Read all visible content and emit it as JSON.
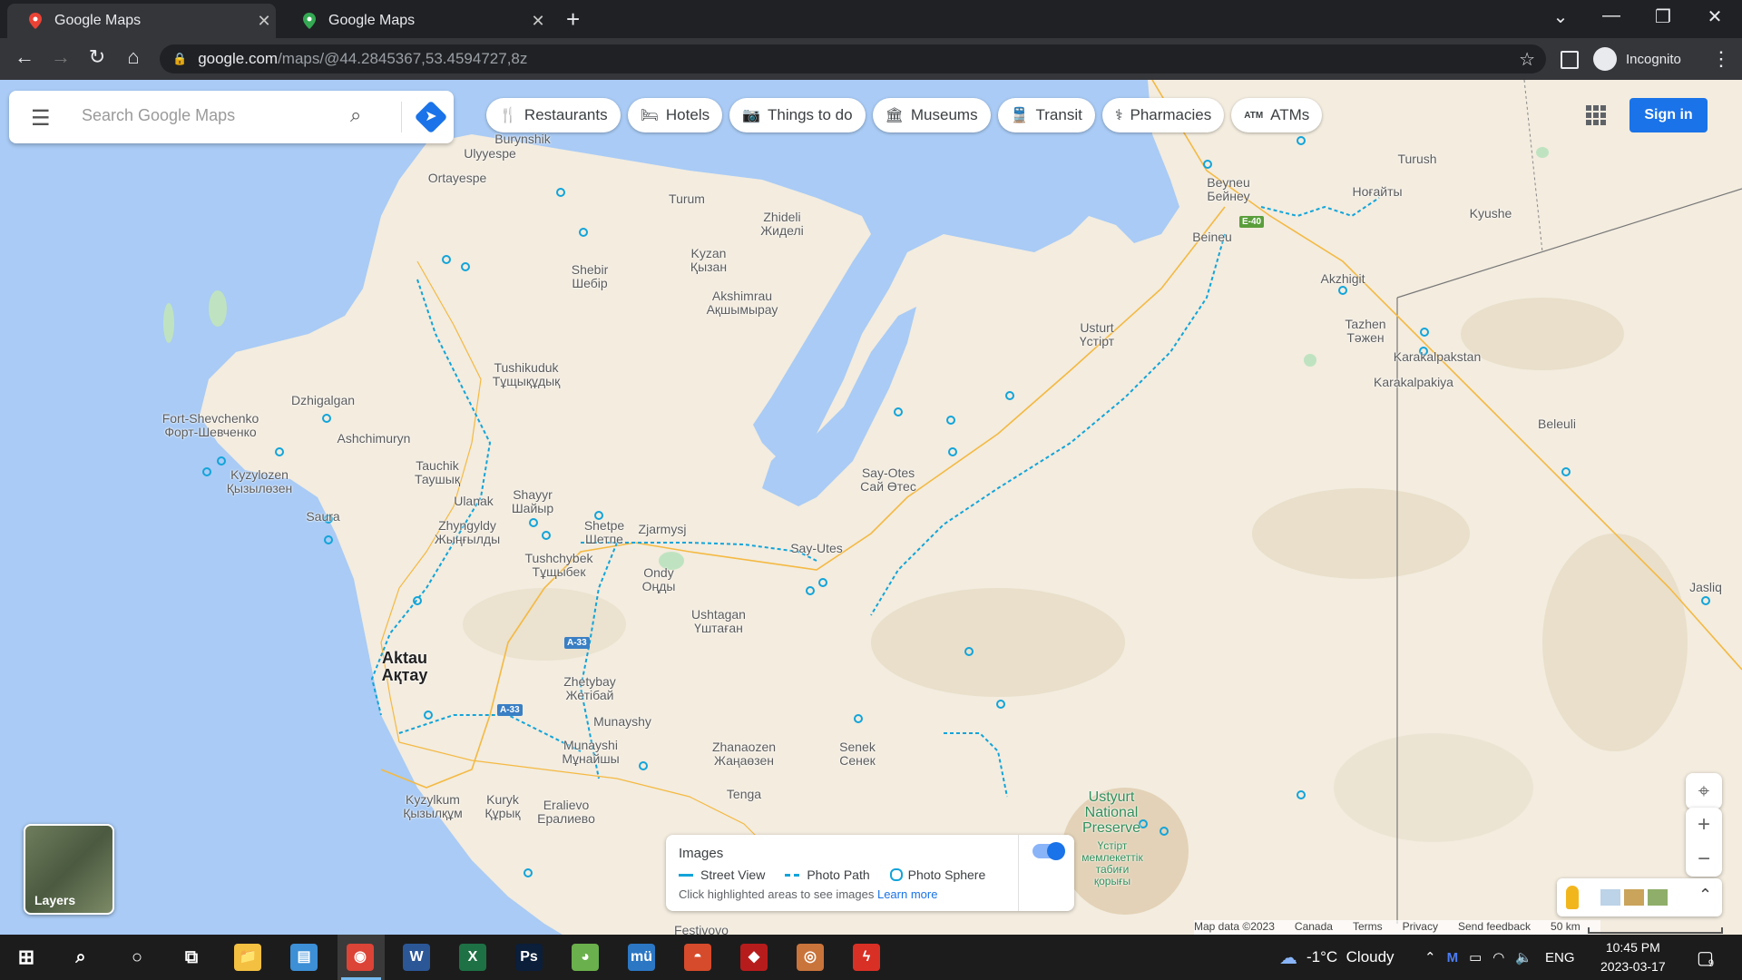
{
  "browser": {
    "tabs": [
      {
        "title": "Google Maps",
        "close": "✕"
      },
      {
        "title": "Google Maps",
        "close": "✕"
      }
    ],
    "new_tab": "+",
    "window_controls": [
      "⌄",
      "—",
      "❐",
      "✕"
    ],
    "nav": {
      "back": "←",
      "forward": "→",
      "reload": "↻",
      "home": "⌂"
    },
    "url_host": "google.com",
    "url_path": "/maps/@44.2845367,53.4594727,8z",
    "profile_label": "Incognito",
    "menu": "⋮",
    "bookmark": "☆"
  },
  "maps": {
    "search_placeholder": "Search Google Maps",
    "chips": [
      {
        "icon": "restaurant-icon",
        "glyph": "🍴",
        "label": "Restaurants"
      },
      {
        "icon": "hotel-icon",
        "glyph": "🛏",
        "label": "Hotels"
      },
      {
        "icon": "camera-icon",
        "glyph": "📷",
        "label": "Things to do"
      },
      {
        "icon": "museum-icon",
        "glyph": "🏛",
        "label": "Museums"
      },
      {
        "icon": "transit-icon",
        "glyph": "🚆",
        "label": "Transit"
      },
      {
        "icon": "pharmacy-icon",
        "glyph": "⚕",
        "label": "Pharmacies"
      },
      {
        "icon": "atm-icon",
        "glyph": "ATM",
        "label": "ATMs"
      }
    ],
    "sign_in": "Sign in",
    "layers_label": "Layers",
    "images_panel": {
      "title": "Images",
      "street_view": "Street View",
      "photo_path": "Photo Path",
      "photo_sphere": "Photo Sphere",
      "hint": "Click highlighted areas to see images",
      "learn_more": "Learn more",
      "toggle_on": true
    },
    "footer": {
      "map_data": "Map data ©2023",
      "region": "Canada",
      "terms": "Terms",
      "privacy": "Privacy",
      "feedback": "Send feedback",
      "scale": "50 km"
    },
    "places": [
      "Burynshik",
      "Ulyyespe",
      "Ortayespe",
      "Turum",
      "Zhideli\nЖиделі",
      "Kyzan\nҚызан",
      "Shebir\nШебір",
      "Akshimrau\nАқшымырау",
      "Tushikuduk\nТұщықұдық",
      "Dzhigalgan",
      "Fort-Shevchenko\nФорт-Шевченко",
      "Ashchimuryn",
      "Tauchik\nТаушық",
      "Kyzylozen\nҚызылөзен",
      "Ulanak",
      "Shayyr\nШайыр",
      "Saura",
      "Zhyngyldy\nЖыңғылды",
      "Shetpe\nШетпе",
      "Zjarmysj",
      "Say-Utes",
      "Tushchybek\nТұщыбек",
      "Ondy\nОңды",
      "Ushtagan\nҮштаған",
      "Aktau\nАқтау",
      "Zhetybay\nЖетібай",
      "Munayshy",
      "Munayshi\nМұнайшы",
      "Zhanaozen\nЖаңаөзен",
      "Tenga",
      "Senek\nСенек",
      "Kyzylkum\nҚызылқұм",
      "Kuryk\nҚұрық",
      "Eralievo\nЕралиево",
      "Festivovo",
      "Ustyurt\nNational\nPreserve",
      "Үстірт\nмемлекеттік\nтабиғи\nқорығы",
      "Say-Otes\nСай Өтес",
      "Usturt\nҮстірт",
      "Beyneu\nБейнеу",
      "Beineu",
      "Turush",
      "Ноғайты",
      "Kyushe",
      "Akzhigit",
      "Tazhen\nТәжен",
      "Karakalpakstan",
      "Karakalpakiya",
      "Beleuli",
      "Jasliq"
    ],
    "road_shields": [
      "A-33",
      "A-33",
      "E-40"
    ]
  },
  "taskbar": {
    "apps": [
      {
        "name": "file-explorer-icon",
        "glyph": "📁",
        "color": "#f4c041"
      },
      {
        "name": "control-panel-icon",
        "glyph": "▤",
        "color": "#3d8fd6"
      },
      {
        "name": "chrome-icon",
        "glyph": "◉",
        "color": "#db4437"
      },
      {
        "name": "word-icon",
        "glyph": "W",
        "color": "#2b5797"
      },
      {
        "name": "excel-icon",
        "glyph": "X",
        "color": "#1e7145"
      },
      {
        "name": "photoshop-icon",
        "glyph": "Ps",
        "color": "#0b1e3a"
      },
      {
        "name": "android-icon",
        "glyph": "◕",
        "color": "#6ab04c"
      },
      {
        "name": "mu-icon",
        "glyph": "mü",
        "color": "#2b77c4"
      },
      {
        "name": "rainbow-icon",
        "glyph": "◓",
        "color": "#d64b2b"
      },
      {
        "name": "game-icon",
        "glyph": "◆",
        "color": "#b71c1c"
      },
      {
        "name": "media-icon",
        "glyph": "◎",
        "color": "#c9743b"
      },
      {
        "name": "flash-icon",
        "glyph": "ϟ",
        "color": "#d93025"
      }
    ],
    "weather": "-1°C  Cloudy",
    "language": "ENG",
    "time": "10:45 PM",
    "date": "2023-03-17",
    "notifications": "9"
  }
}
